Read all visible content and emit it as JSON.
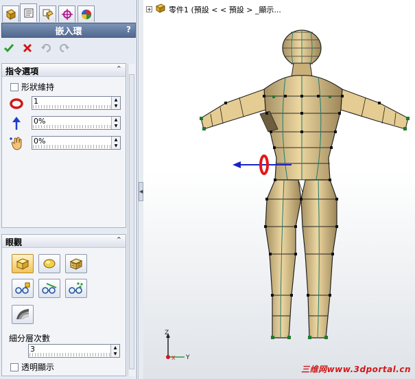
{
  "tabs": [
    {
      "name": "feature-manager",
      "icon": "feature-tree-icon"
    },
    {
      "name": "property-manager",
      "icon": "property-manager-icon"
    },
    {
      "name": "configuration-manager",
      "icon": "configuration-icon"
    },
    {
      "name": "dimxpert",
      "icon": "crosshair-icon"
    },
    {
      "name": "display-manager",
      "icon": "appearance-icon"
    }
  ],
  "panel": {
    "title": "嵌入環",
    "help": "?",
    "confirm_icon": "check-icon",
    "cancel_icon": "close-icon",
    "undo_icon": "undo-icon",
    "redo_icon": "redo-icon"
  },
  "command_options": {
    "title": "指令選項",
    "collapse": "⩓",
    "keep_shape_label": "形狀維持",
    "keep_shape_checked": false,
    "params": [
      {
        "icon": "ring-icon",
        "value": "1"
      },
      {
        "icon": "arrow-up-icon",
        "value": "0%"
      },
      {
        "icon": "hand-drag-icon",
        "value": "0%"
      }
    ]
  },
  "display": {
    "title": "眼觀",
    "collapse": "⩓",
    "buttons_row1": [
      {
        "name": "shaded-box-icon",
        "active": true
      },
      {
        "name": "smooth-shaded-icon",
        "active": false
      },
      {
        "name": "wireframe-box-icon",
        "active": false
      }
    ],
    "buttons_row2": [
      {
        "name": "control-points-icon",
        "active": false
      },
      {
        "name": "edge-control-icon",
        "active": false
      },
      {
        "name": "vertex-control-icon",
        "active": false
      }
    ],
    "subdivision_icon": "subdivision-surface-icon",
    "subdivision_label": "細分層次數",
    "subdivision_value": "3",
    "transparent_label": "透明顯示",
    "transparent_checked": false
  },
  "splitter_icon": "collapse-arrow-icon",
  "tree": {
    "expand": "+",
    "part_icon": "part-icon",
    "text": "零件1 (預設 < < 預設 > _顯示..."
  },
  "axis": {
    "z": "Z",
    "y": "Y",
    "x": "X"
  },
  "watermark": "三维网www.3dportal.cn",
  "colors": {
    "panel_bg": "#e6eaf2",
    "title_bar": "#52698f",
    "mesh_fill": "#e8cf98",
    "mesh_shade": "#8f7d58",
    "mesh_edges": "#2a2a2a",
    "mesh_vertices": "#1e7a2e",
    "ring": "#e01818",
    "manipulator_arrow": "#1a22c8",
    "watermark": "#d01818"
  }
}
